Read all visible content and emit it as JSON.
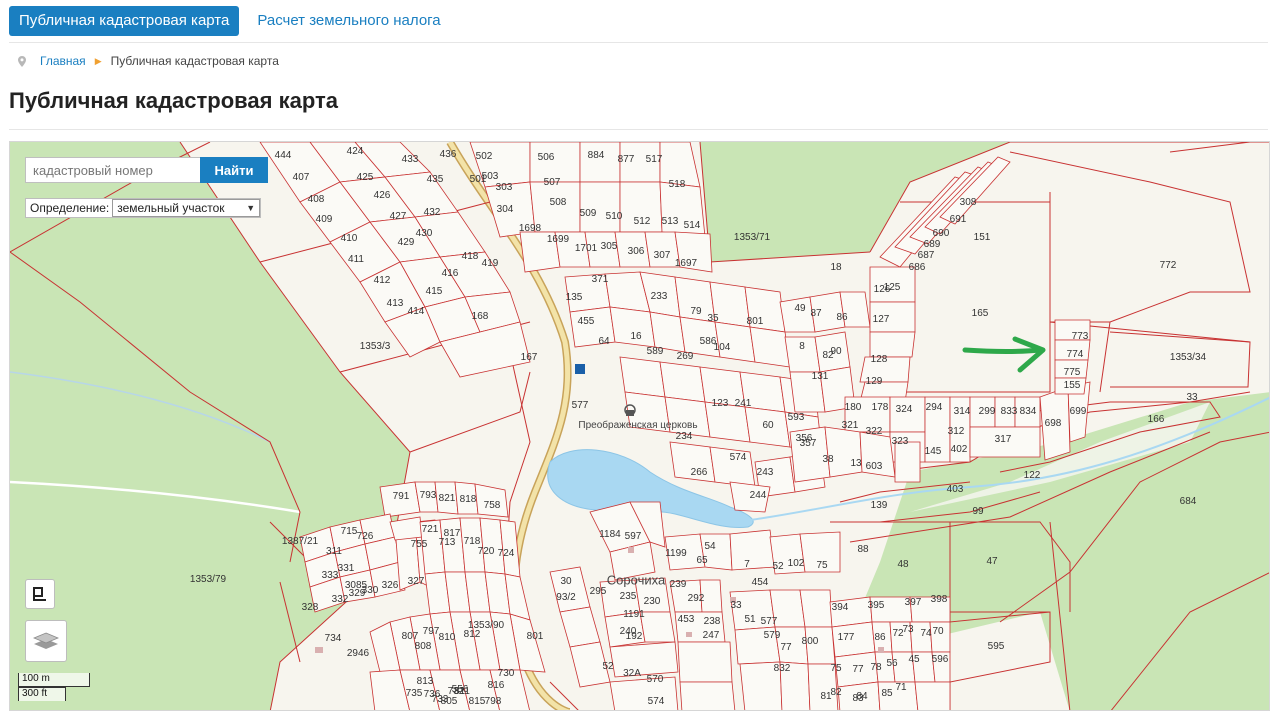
{
  "tabs": [
    {
      "label": "Публичная кадастровая карта",
      "active": true
    },
    {
      "label": "Расчет земельного налога",
      "active": false
    }
  ],
  "breadcrumb": {
    "home": "Главная",
    "current": "Публичная кадастровая карта"
  },
  "page_title": "Публичная кадастровая карта",
  "search": {
    "placeholder": "кадастровый номер",
    "button": "Найти"
  },
  "definition": {
    "label": "Определение:",
    "value": "земельный участок"
  },
  "scale": {
    "metric": "100 m",
    "imperial": "300 ft"
  },
  "colors": {
    "accent": "#1a7fc1",
    "parcel_line": "#c83232",
    "forest": "#c9e5b5",
    "water": "#a9d8f2",
    "arrow": "#2ea84a"
  },
  "icons": {
    "pin": "map-pin-icon",
    "fullscreen": "fullscreen-icon",
    "layers": "layers-icon",
    "arrow": "pointer-arrow-icon",
    "church": "church-icon"
  },
  "map": {
    "places": [
      "Сорочиха",
      "Преображенская церковь"
    ],
    "parcels": [
      "444",
      "407",
      "408",
      "409",
      "410",
      "411",
      "412",
      "413",
      "414",
      "415",
      "416",
      "418",
      "419",
      "168",
      "424",
      "425",
      "426",
      "427",
      "429",
      "430",
      "432",
      "433",
      "435",
      "436",
      "502",
      "503",
      "501",
      "303",
      "304",
      "506",
      "507",
      "508",
      "509",
      "1698",
      "1699",
      "1701",
      "884",
      "877",
      "517",
      "518",
      "510",
      "512",
      "513",
      "514",
      "305",
      "306",
      "307",
      "1697",
      "1353/71",
      "18",
      "135",
      "371",
      "455",
      "16",
      "64",
      "233",
      "79",
      "589",
      "269",
      "586",
      "104",
      "35",
      "49",
      "87",
      "86",
      "8",
      "90",
      "82",
      "127",
      "126",
      "125",
      "128",
      "131",
      "129",
      "180",
      "178",
      "324",
      "321",
      "322",
      "323",
      "294",
      "314",
      "312",
      "299",
      "833",
      "834",
      "698",
      "699",
      "402",
      "145",
      "317",
      "1353/3",
      "167",
      "577",
      "234",
      "123",
      "241",
      "60",
      "593",
      "357",
      "356",
      "38",
      "13",
      "603",
      "266",
      "574",
      "243",
      "244",
      "139",
      "403",
      "99",
      "122",
      "33",
      "166",
      "165",
      "151",
      "772",
      "773",
      "774",
      "775",
      "155",
      "1353/34",
      "684",
      "686",
      "687",
      "689",
      "690",
      "691",
      "308",
      "791",
      "793",
      "821",
      "818",
      "758",
      "721",
      "817",
      "755",
      "713",
      "718",
      "720",
      "724",
      "715",
      "726",
      "311",
      "331",
      "333",
      "329",
      "332",
      "330",
      "326",
      "327",
      "328",
      "734",
      "2946",
      "3085",
      "1353/79",
      "1387/21",
      "1353/90",
      "801",
      "730",
      "807",
      "797",
      "808",
      "810",
      "812",
      "813",
      "735",
      "736",
      "732",
      "733",
      "811",
      "816",
      "815",
      "805",
      "798",
      "556",
      "1184",
      "597",
      "1199",
      "65",
      "54",
      "295",
      "30",
      "93/2",
      "235",
      "1191",
      "230",
      "240",
      "192",
      "239",
      "292",
      "453",
      "247",
      "238",
      "33",
      "51",
      "579",
      "577",
      "7",
      "454",
      "52",
      "102",
      "75",
      "88",
      "48",
      "47",
      "394",
      "395",
      "397",
      "398",
      "177",
      "86",
      "72",
      "73",
      "74",
      "70",
      "75",
      "77",
      "78",
      "56",
      "45",
      "596",
      "595",
      "570",
      "574",
      "52",
      "32A",
      "801",
      "800",
      "77",
      "832",
      "81",
      "83",
      "82",
      "84",
      "85",
      "71"
    ]
  }
}
